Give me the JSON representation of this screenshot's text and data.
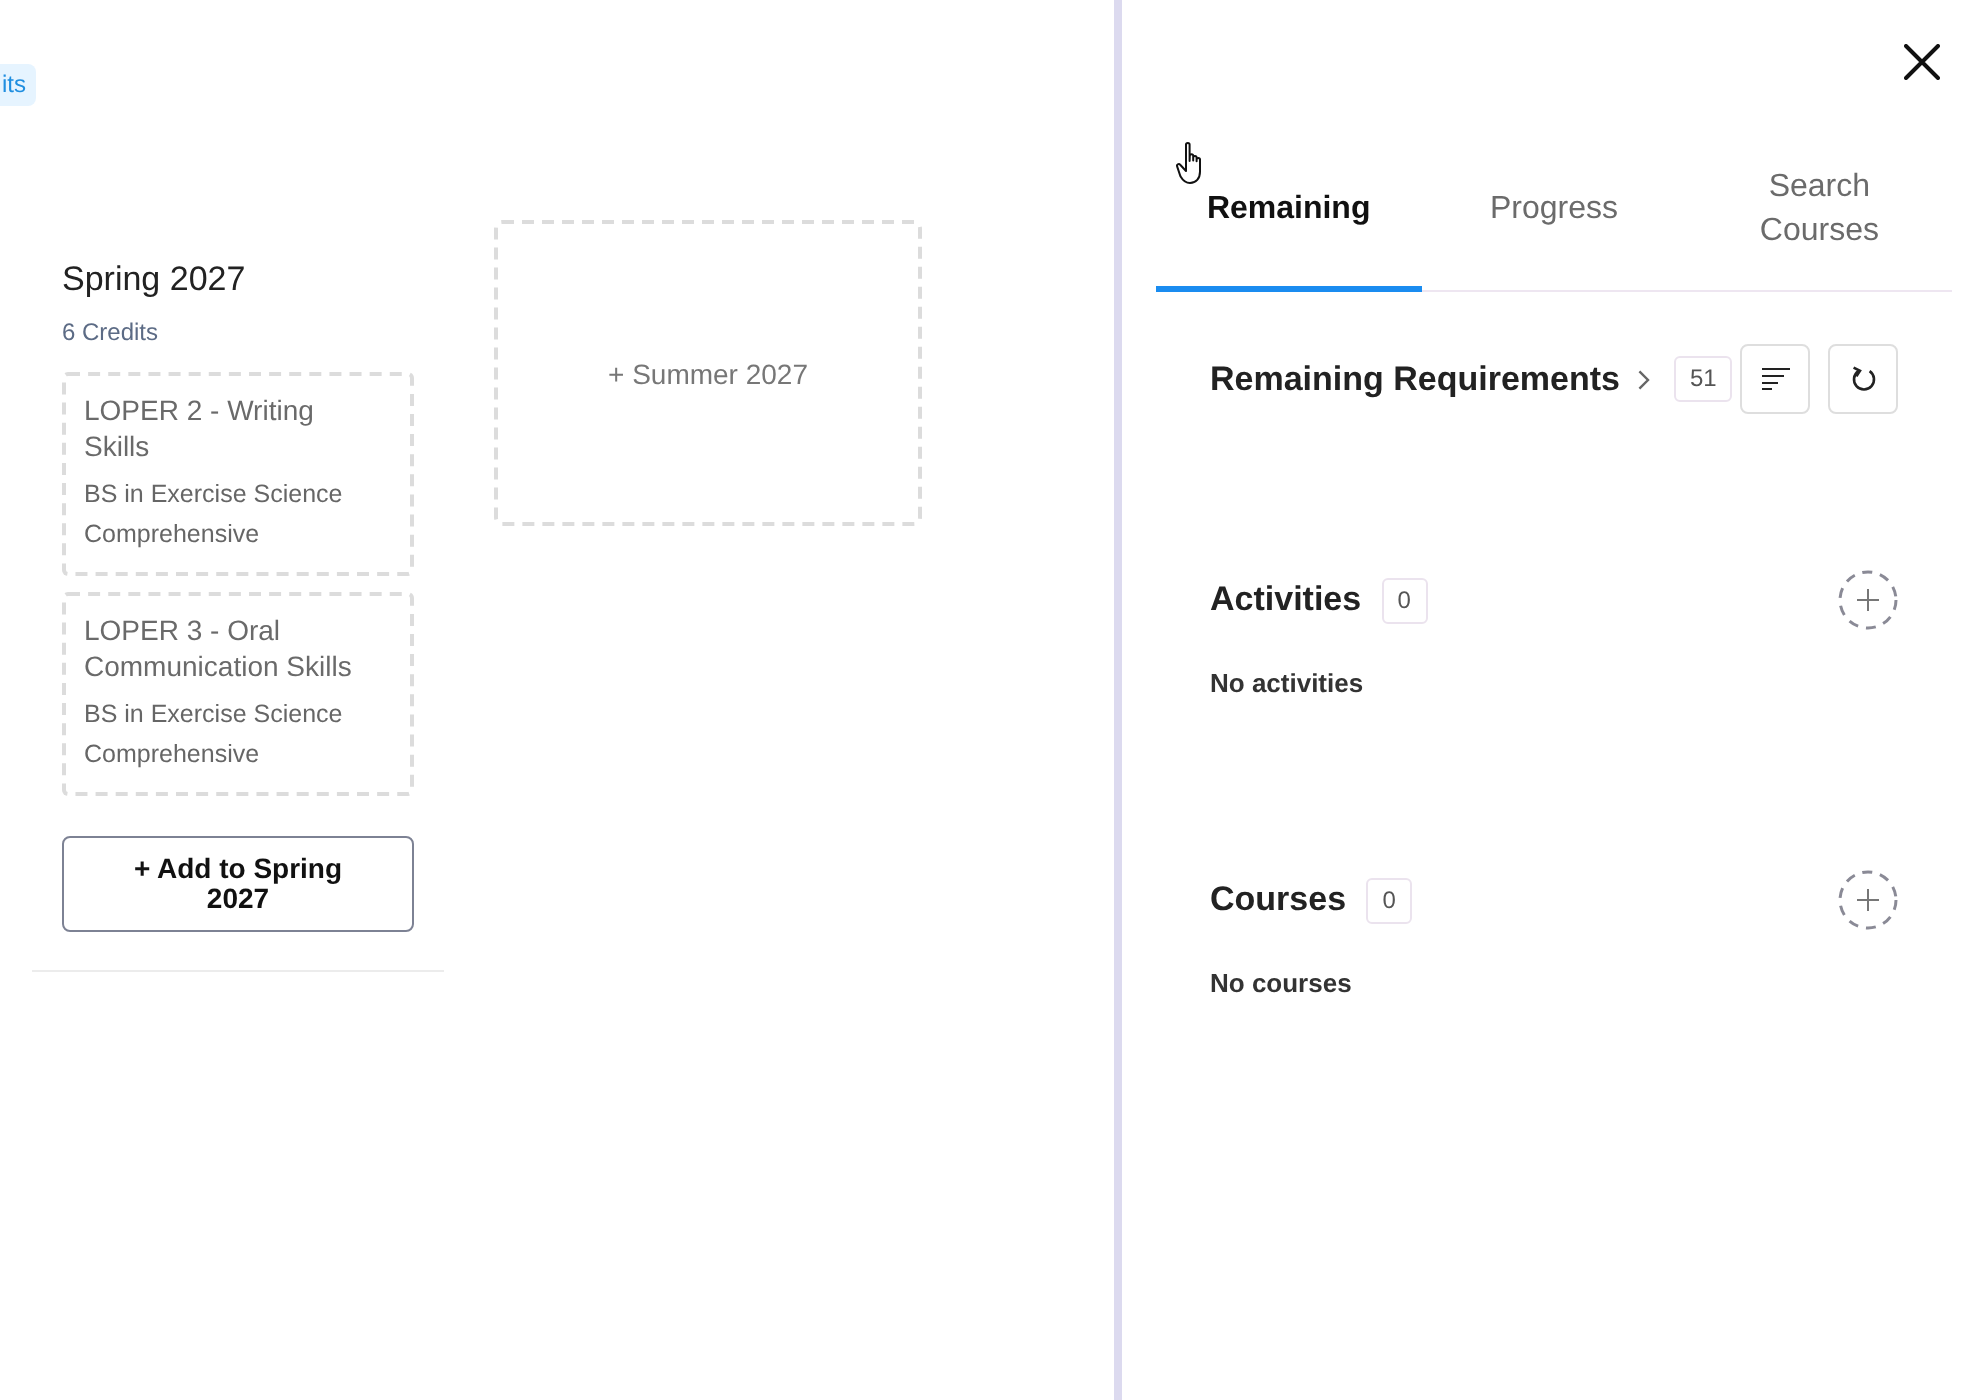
{
  "credits_badge": {
    "label": "its"
  },
  "terms": [
    {
      "title": "Spring 2027",
      "credits": "6 Credits",
      "courses": [
        {
          "title": "LOPER 2 - Writing Skills",
          "program": "BS in Exercise Science Comprehensive"
        },
        {
          "title": "LOPER 3 - Oral Communication Skills",
          "program": "BS in Exercise Science Comprehensive"
        }
      ],
      "add_button": "+ Add to Spring 2027"
    }
  ],
  "add_term": {
    "label": "+ Summer 2027"
  },
  "panel": {
    "tabs": [
      {
        "label": "Remaining",
        "selected": true
      },
      {
        "label": "Progress",
        "selected": false
      },
      {
        "label": "Search Courses",
        "selected": false
      }
    ],
    "sections": [
      {
        "kind": "requirements",
        "title": "Remaining Requirements",
        "count": "51"
      },
      {
        "kind": "list",
        "title": "Activities",
        "count": "0",
        "empty_text": "No activities"
      },
      {
        "kind": "list",
        "title": "Courses",
        "count": "0",
        "empty_text": "No courses"
      }
    ]
  }
}
